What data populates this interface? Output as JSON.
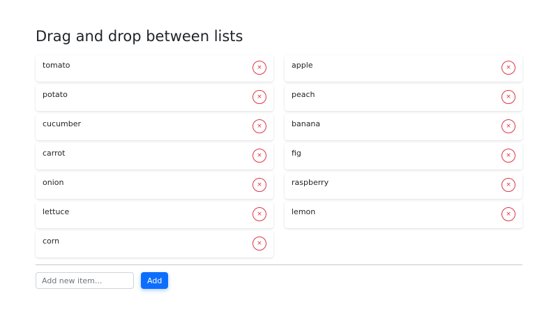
{
  "page": {
    "title": "Drag and drop between lists"
  },
  "lists": {
    "left": {
      "items": [
        {
          "label": "tomato"
        },
        {
          "label": "potato"
        },
        {
          "label": "cucumber"
        },
        {
          "label": "carrot"
        },
        {
          "label": "onion"
        },
        {
          "label": "lettuce"
        },
        {
          "label": "corn"
        }
      ]
    },
    "right": {
      "items": [
        {
          "label": "apple"
        },
        {
          "label": "peach"
        },
        {
          "label": "banana"
        },
        {
          "label": "fig"
        },
        {
          "label": "raspberry"
        },
        {
          "label": "lemon"
        }
      ]
    },
    "remove_glyph": "×",
    "remove_icon": "close-icon"
  },
  "add_form": {
    "input_value": "",
    "input_placeholder": "Add new item...",
    "button_label": "Add"
  },
  "colors": {
    "accent": "#0d6efd",
    "danger": "#dc3545",
    "text": "#212529"
  }
}
